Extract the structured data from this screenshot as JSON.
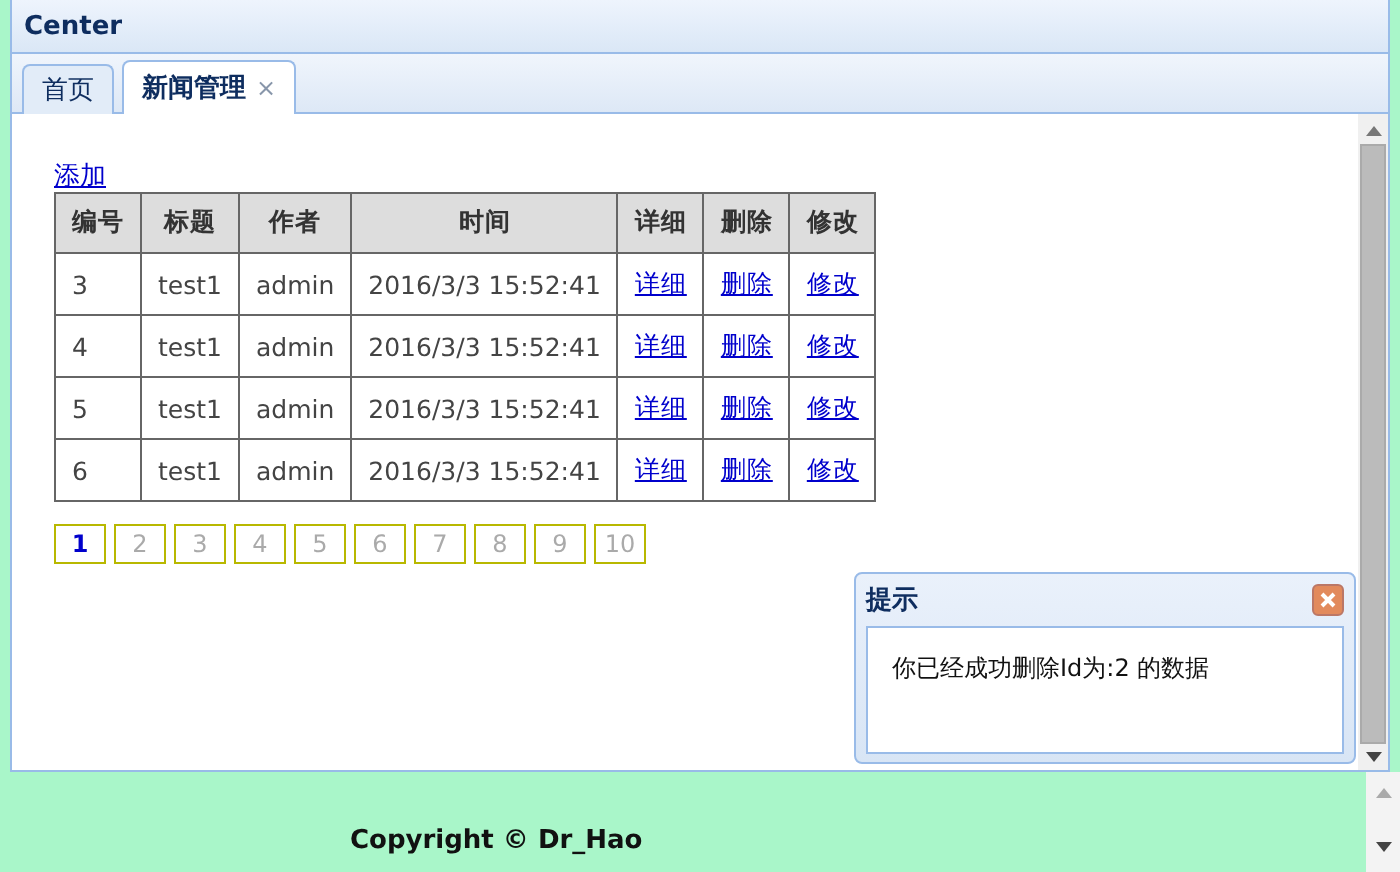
{
  "panel": {
    "title": "Center"
  },
  "tabs": [
    {
      "label": "首页",
      "selected": false,
      "closable": false
    },
    {
      "label": "新闻管理",
      "selected": true,
      "closable": true,
      "close_glyph": "×"
    }
  ],
  "add_link": "添加",
  "table": {
    "columns": [
      {
        "label": "编号",
        "kind": "text"
      },
      {
        "label": "标题",
        "kind": "text"
      },
      {
        "label": "作者",
        "kind": "text"
      },
      {
        "label": "时间",
        "kind": "text"
      },
      {
        "label": "详细",
        "kind": "link"
      },
      {
        "label": "删除",
        "kind": "link"
      },
      {
        "label": "修改",
        "kind": "link"
      }
    ],
    "rows": [
      [
        "3",
        "test1",
        "admin",
        "2016/3/3 15:52:41",
        "详细",
        "删除",
        "修改"
      ],
      [
        "4",
        "test1",
        "admin",
        "2016/3/3 15:52:41",
        "详细",
        "删除",
        "修改"
      ],
      [
        "5",
        "test1",
        "admin",
        "2016/3/3 15:52:41",
        "详细",
        "删除",
        "修改"
      ],
      [
        "6",
        "test1",
        "admin",
        "2016/3/3 15:52:41",
        "详细",
        "删除",
        "修改"
      ]
    ]
  },
  "pagination": [
    {
      "label": "1",
      "selected": true
    },
    {
      "label": "2",
      "selected": false
    },
    {
      "label": "3",
      "selected": false
    },
    {
      "label": "4",
      "selected": false
    },
    {
      "label": "5",
      "selected": false
    },
    {
      "label": "6",
      "selected": false
    },
    {
      "label": "7",
      "selected": false
    },
    {
      "label": "8",
      "selected": false
    },
    {
      "label": "9",
      "selected": false
    },
    {
      "label": "10",
      "selected": false
    }
  ],
  "dialog": {
    "title": "提示",
    "message": "你已经成功删除Id为:2 的数据"
  },
  "footer": {
    "copyright": "Copyright © Dr_Hao"
  }
}
